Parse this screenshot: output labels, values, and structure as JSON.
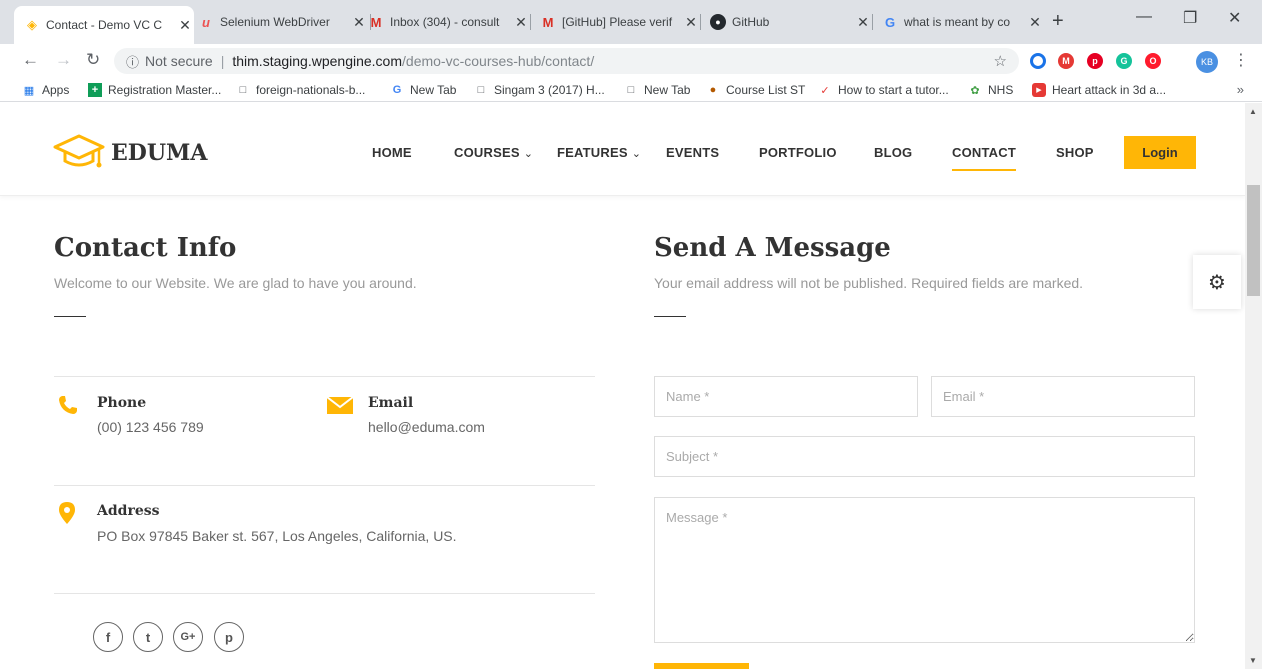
{
  "browser": {
    "tabs": [
      {
        "title": "Contact - Demo VC C",
        "icon": "eduma-icon",
        "active": true
      },
      {
        "title": "Selenium WebDriver",
        "icon": "udemy-icon"
      },
      {
        "title": "Inbox (304) - consult",
        "icon": "gmail-icon"
      },
      {
        "title": "[GitHub] Please verif",
        "icon": "gmail-icon"
      },
      {
        "title": "GitHub",
        "icon": "github-icon"
      },
      {
        "title": "what is meant by co",
        "icon": "google-icon"
      }
    ],
    "address": {
      "security": "Not secure",
      "host": "thim.staging.wpengine.com",
      "path": "/demo-vc-courses-hub/contact/"
    },
    "profile_initials": "KB",
    "bookmarks": [
      {
        "label": "Apps",
        "icon": "apps-icon"
      },
      {
        "label": "Registration Master...",
        "icon": "plus-icon"
      },
      {
        "label": "foreign-nationals-b...",
        "icon": "page-icon"
      },
      {
        "label": "New Tab",
        "icon": "google-icon"
      },
      {
        "label": "Singam 3 (2017) H...",
        "icon": "page-icon"
      },
      {
        "label": "New Tab",
        "icon": "page-icon"
      },
      {
        "label": "Course List ST",
        "icon": "course-icon"
      },
      {
        "label": "How to start a tutor...",
        "icon": "brush-icon"
      },
      {
        "label": "NHS",
        "icon": "nhs-icon"
      },
      {
        "label": "Heart attack in 3d a...",
        "icon": "youtube-icon"
      }
    ]
  },
  "site": {
    "brand": "EDUMA",
    "accent": "#ffb606",
    "nav": [
      {
        "label": "HOME"
      },
      {
        "label": "COURSES",
        "dropdown": true
      },
      {
        "label": "FEATURES",
        "dropdown": true
      },
      {
        "label": "EVENTS"
      },
      {
        "label": "PORTFOLIO"
      },
      {
        "label": "BLOG"
      },
      {
        "label": "CONTACT",
        "active": true
      },
      {
        "label": "SHOP"
      }
    ],
    "login_label": "Login"
  },
  "contact_info": {
    "title": "Contact Info",
    "subtitle": "Welcome to our Website. We are glad to have you around.",
    "phone": {
      "label": "Phone",
      "value": "(00) 123 456 789"
    },
    "email": {
      "label": "Email",
      "value": "hello@eduma.com"
    },
    "address": {
      "label": "Address",
      "value": "PO Box 97845 Baker st. 567, Los Angeles, California, US."
    },
    "social": [
      "facebook-icon",
      "twitter-icon",
      "google-plus-icon",
      "pinterest-icon"
    ]
  },
  "message_form": {
    "title": "Send A Message",
    "subtitle": "Your email address will not be published. Required fields are marked.",
    "name_placeholder": "Name *",
    "email_placeholder": "Email *",
    "subject_placeholder": "Subject *",
    "message_placeholder": "Message *"
  }
}
